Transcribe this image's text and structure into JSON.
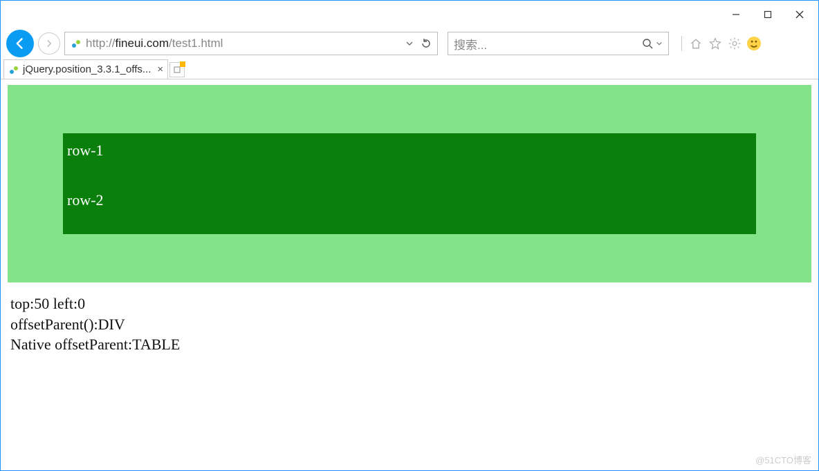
{
  "window": {
    "url_prefix": "http://",
    "url_host": "fineui.com",
    "url_path": "/test1.html",
    "search_placeholder": "搜索..."
  },
  "tab": {
    "title": "jQuery.position_3.3.1_offs..."
  },
  "page": {
    "row1": "row-1",
    "row2": "row-2",
    "results": {
      "line1": "top:50 left:0",
      "line2": "offsetParent():DIV",
      "line3": "Native offsetParent:TABLE"
    }
  },
  "watermark": "@51CTO博客"
}
